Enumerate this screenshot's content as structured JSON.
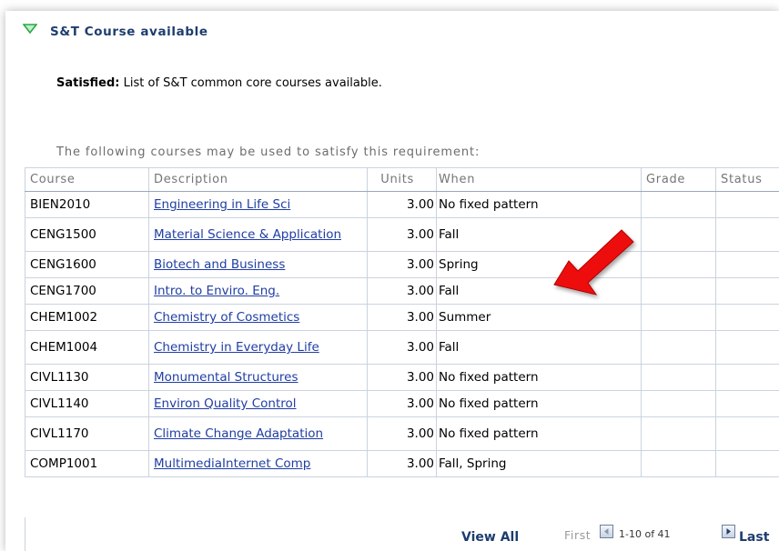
{
  "section": {
    "title": "S&T Course available",
    "status_label": "Satisfied:",
    "status_text": "List of S&T common core courses available.",
    "caption": "The following courses may be used to satisfy this requirement:"
  },
  "table": {
    "columns": [
      "Course",
      "Description",
      "Units",
      "When",
      "Grade",
      "Status"
    ],
    "rows": [
      {
        "course": "BIEN2010",
        "description": "Engineering in Life Sci",
        "units": "3.00",
        "when": "No fixed pattern",
        "grade": "",
        "status": ""
      },
      {
        "course": "CENG1500",
        "description": "Material Science & Application",
        "units": "3.00",
        "when": "Fall",
        "grade": "",
        "status": ""
      },
      {
        "course": "CENG1600",
        "description": "Biotech and Business",
        "units": "3.00",
        "when": "Spring",
        "grade": "",
        "status": ""
      },
      {
        "course": "CENG1700",
        "description": "Intro. to Enviro. Eng.",
        "units": "3.00",
        "when": "Fall",
        "grade": "",
        "status": ""
      },
      {
        "course": "CHEM1002",
        "description": "Chemistry of Cosmetics",
        "units": "3.00",
        "when": "Summer",
        "grade": "",
        "status": ""
      },
      {
        "course": "CHEM1004",
        "description": "Chemistry in Everyday Life",
        "units": "3.00",
        "when": "Fall",
        "grade": "",
        "status": ""
      },
      {
        "course": "CIVL1130",
        "description": "Monumental Structures",
        "units": "3.00",
        "when": "No fixed pattern",
        "grade": "",
        "status": ""
      },
      {
        "course": "CIVL1140",
        "description": "Environ Quality Control",
        "units": "3.00",
        "when": "No fixed pattern",
        "grade": "",
        "status": ""
      },
      {
        "course": "CIVL1170",
        "description": "Climate Change Adaptation",
        "units": "3.00",
        "when": "No fixed pattern",
        "grade": "",
        "status": ""
      },
      {
        "course": "COMP1001",
        "description": "MultimediaInternet Comp",
        "units": "3.00",
        "when": "Fall, Spring",
        "grade": "",
        "status": ""
      }
    ]
  },
  "pagination": {
    "view_all": "View All",
    "first": "First",
    "range": "1-10 of 41",
    "last": "Last"
  },
  "colors": {
    "header_text": "#1e3d6e",
    "link": "#1f3ea3",
    "triangle": "#2aa54a",
    "annotation_arrow": "#ee1111"
  },
  "icons": {
    "expand": "triangle-down-icon",
    "prev": "arrow-left-icon",
    "next": "arrow-right-icon",
    "annotation": "red-arrow-icon"
  }
}
